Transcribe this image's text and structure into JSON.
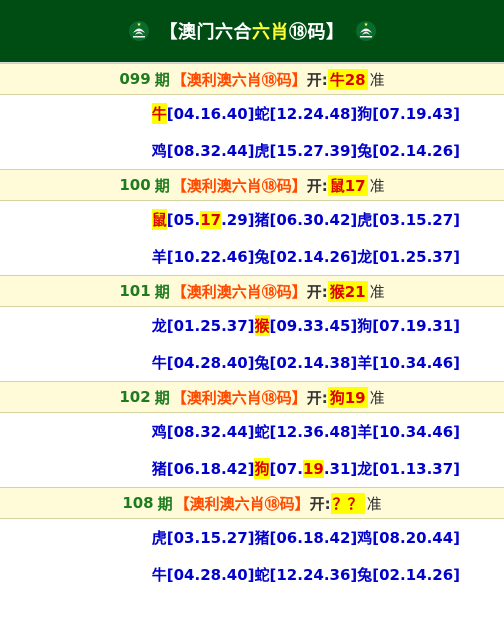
{
  "header": {
    "bracket_open": "【",
    "title_white": "澳门六合",
    "title_yellow": "六肖",
    "title_white2": "⑱码",
    "bracket_close": "】"
  },
  "label_kai": "开:",
  "label_zhun": "准",
  "label_qi": "期",
  "periods": [
    {
      "num": "099",
      "label": "【澳利澳六肖⑱码】",
      "result": "牛28",
      "lines": [
        [
          {
            "t": "牛",
            "hl": true
          },
          {
            "t": "[04.16.40]"
          },
          {
            "t": "蛇"
          },
          {
            "t": "[12.24.48]"
          },
          {
            "t": "狗"
          },
          {
            "t": "[07.19.43]"
          }
        ],
        [
          {
            "t": "鸡"
          },
          {
            "t": "[08.32.44]"
          },
          {
            "t": "虎"
          },
          {
            "t": "[15.27.39]"
          },
          {
            "t": "兔"
          },
          {
            "t": "[02.14.26]"
          }
        ]
      ]
    },
    {
      "num": "100",
      "label": "【澳利澳六肖⑱码】",
      "result": "鼠17",
      "lines": [
        [
          {
            "t": "鼠",
            "hl": true
          },
          {
            "t": "[05."
          },
          {
            "t": "17",
            "hl": true
          },
          {
            "t": ".29]"
          },
          {
            "t": "猪"
          },
          {
            "t": "[06.30.42]"
          },
          {
            "t": "虎"
          },
          {
            "t": "[03.15.27]"
          }
        ],
        [
          {
            "t": "羊"
          },
          {
            "t": "[10.22.46]"
          },
          {
            "t": "兔"
          },
          {
            "t": "[02.14.26]"
          },
          {
            "t": "龙"
          },
          {
            "t": "[01.25.37]"
          }
        ]
      ]
    },
    {
      "num": "101",
      "label": "【澳利澳六肖⑱码】",
      "result": "猴21",
      "lines": [
        [
          {
            "t": "龙"
          },
          {
            "t": "[01.25.37]"
          },
          {
            "t": "猴",
            "hl": true
          },
          {
            "t": "[09.33.45]"
          },
          {
            "t": "狗"
          },
          {
            "t": "[07.19.31]"
          }
        ],
        [
          {
            "t": "牛"
          },
          {
            "t": "[04.28.40]"
          },
          {
            "t": "兔"
          },
          {
            "t": "[02.14.38]"
          },
          {
            "t": "羊"
          },
          {
            "t": "[10.34.46]"
          }
        ]
      ]
    },
    {
      "num": "102",
      "label": "【澳利澳六肖⑱码】",
      "result": "狗19",
      "lines": [
        [
          {
            "t": "鸡"
          },
          {
            "t": "[08.32.44]"
          },
          {
            "t": "蛇"
          },
          {
            "t": "[12.36.48]"
          },
          {
            "t": "羊"
          },
          {
            "t": "[10.34.46]"
          }
        ],
        [
          {
            "t": "猪"
          },
          {
            "t": "[06.18.42]"
          },
          {
            "t": "狗",
            "hl": true
          },
          {
            "t": "[07."
          },
          {
            "t": "19",
            "hl": true
          },
          {
            "t": ".31]"
          },
          {
            "t": "龙"
          },
          {
            "t": "[01.13.37]"
          }
        ]
      ]
    },
    {
      "num": "108",
      "label": "【澳利澳六肖⑱码】",
      "result": "？？",
      "lines": [
        [
          {
            "t": "虎"
          },
          {
            "t": "[03.15.27]"
          },
          {
            "t": "猪"
          },
          {
            "t": "[06.18.42]"
          },
          {
            "t": "鸡"
          },
          {
            "t": "[08.20.44]"
          }
        ],
        [
          {
            "t": "牛"
          },
          {
            "t": "[04.28.40]"
          },
          {
            "t": "蛇"
          },
          {
            "t": "[12.24.36]"
          },
          {
            "t": "兔"
          },
          {
            "t": "[02.14.26]"
          }
        ]
      ]
    }
  ]
}
